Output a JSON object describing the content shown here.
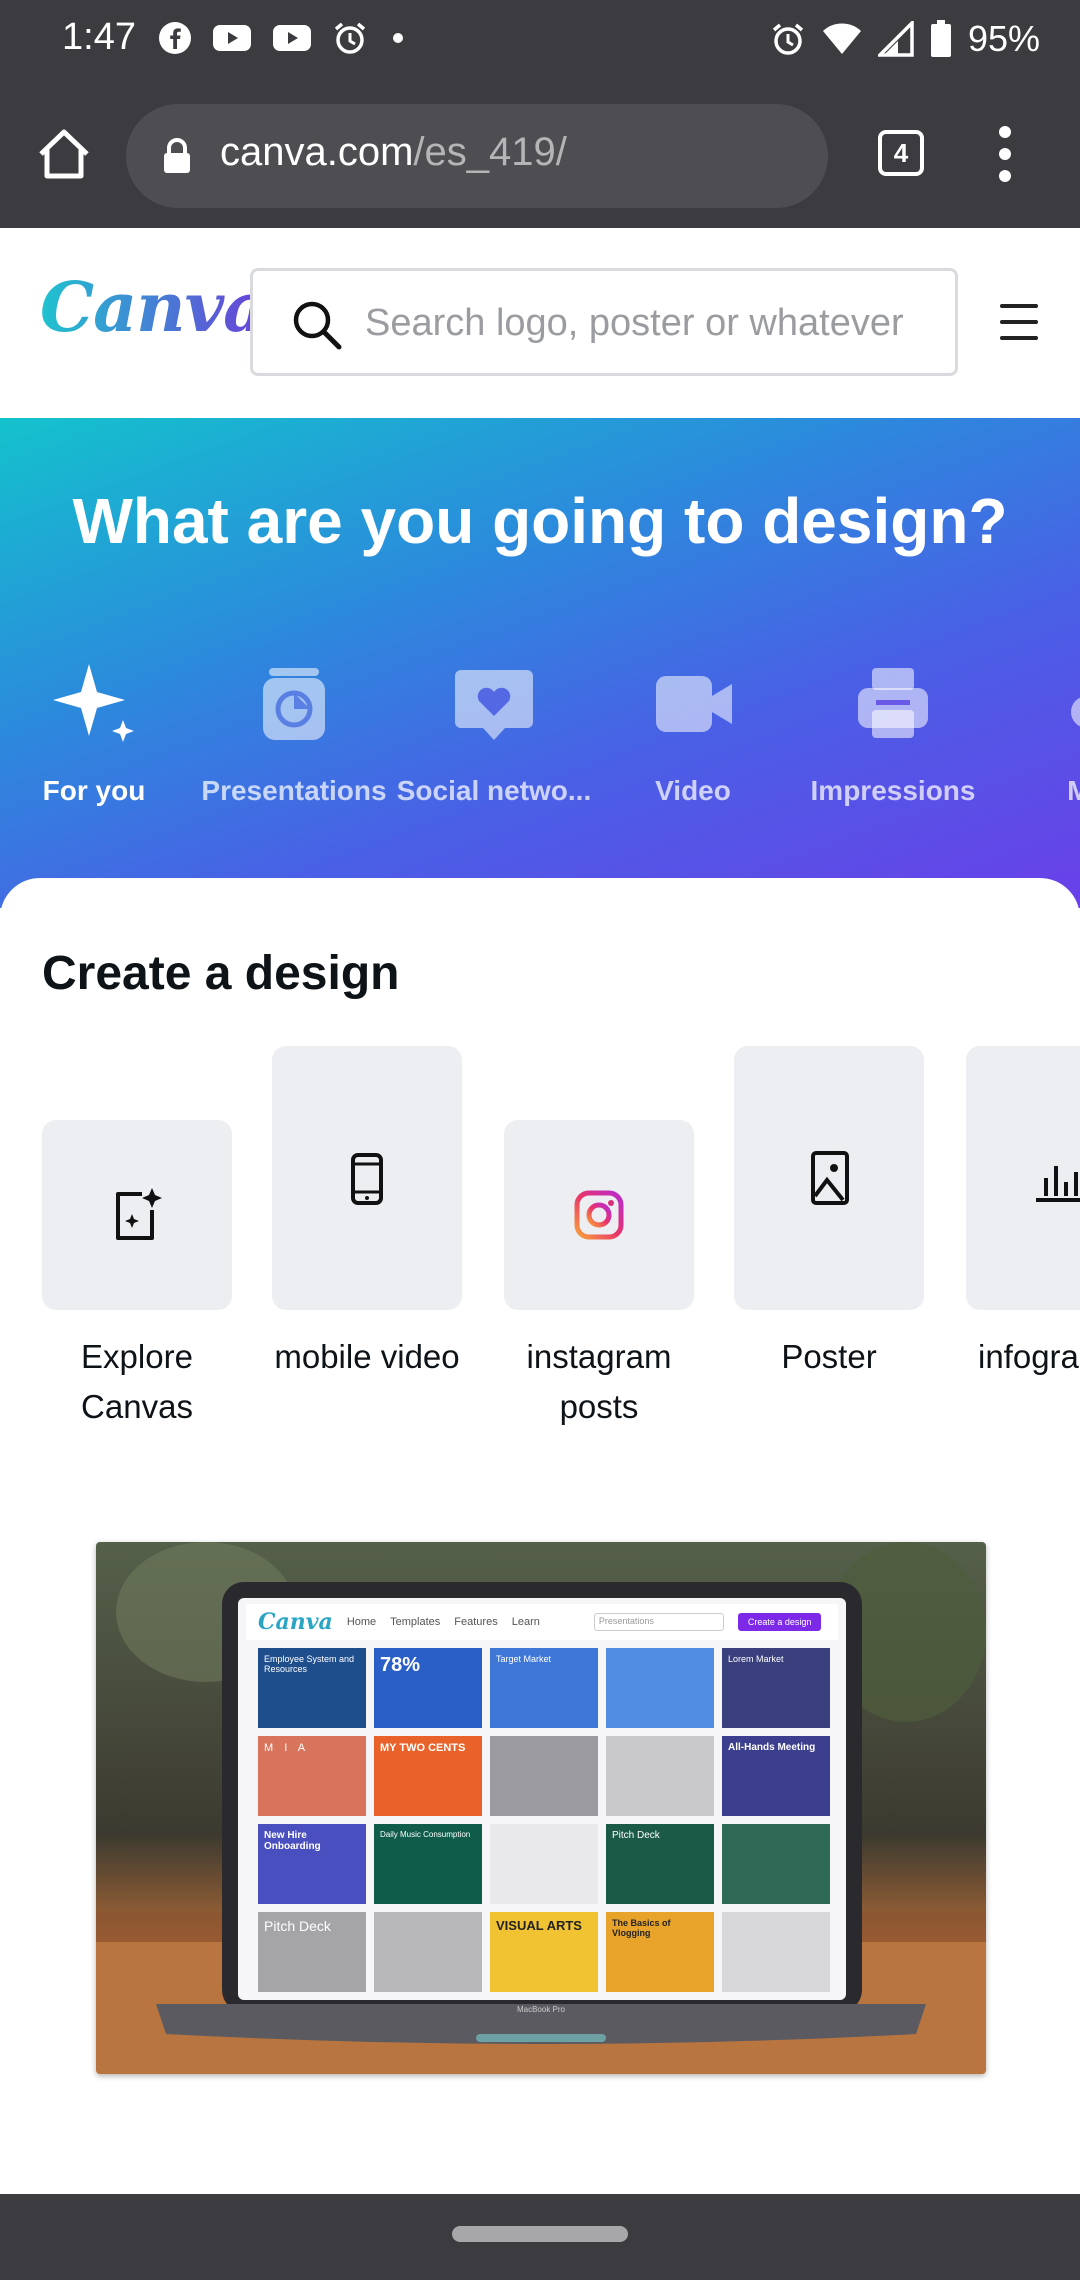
{
  "status_bar": {
    "time": "1:47",
    "battery": "95%",
    "left_icons": [
      "facebook-icon",
      "youtube-icon",
      "youtube-icon",
      "alarm-icon",
      "dot-icon"
    ],
    "right_icons": [
      "alarm-icon",
      "wifi-icon",
      "signal-icon",
      "battery-icon"
    ]
  },
  "browser": {
    "url_host": "canva.com",
    "url_path": "/es_419/",
    "tab_count": "4"
  },
  "header": {
    "logo": "Canva",
    "search_placeholder": "Search logo, poster or whatever"
  },
  "hero": {
    "title": "What are you going to design?",
    "categories": [
      {
        "label": "For you",
        "icon": "sparkle-icon",
        "active": true
      },
      {
        "label": "Presentations",
        "icon": "presentation-icon"
      },
      {
        "label": "Social netwo...",
        "icon": "heart-chat-icon"
      },
      {
        "label": "Video",
        "icon": "video-camera-icon"
      },
      {
        "label": "Impressions",
        "icon": "printer-icon"
      },
      {
        "label": "Mar",
        "icon": "megaphone-icon"
      }
    ]
  },
  "create": {
    "title": "Create a design",
    "cards": [
      {
        "label": "Explore Canvas",
        "icon": "sparkle-doc-icon"
      },
      {
        "label": "mobile video",
        "icon": "phone-icon"
      },
      {
        "label": "instagram posts",
        "icon": "instagram-icon"
      },
      {
        "label": "Poster",
        "icon": "poster-icon"
      },
      {
        "label": "infogra",
        "icon": "bar-chart-icon"
      }
    ]
  },
  "laptop_screen": {
    "logo": "Canva",
    "nav": [
      "Home",
      "Templates",
      "Features",
      "Learn"
    ],
    "search_placeholder": "Presentations",
    "cta": "Create a design",
    "tiles": [
      "Employee System and Resources",
      "78%",
      "Target Market",
      "",
      "Lorem Market",
      "M I A",
      "MY TWO CENTS",
      "",
      "",
      "All-Hands Meeting",
      "New Hire Onboarding",
      "Daily Music Consumption",
      "",
      "Pitch Deck",
      "",
      "Pitch Deck",
      "",
      "VISUAL ARTS",
      "The Basics of Vlogging",
      ""
    ],
    "brand": "MacBook Pro"
  },
  "colors": {
    "chrome": "#3c3c40",
    "hero_start": "#14c2cd",
    "hero_end": "#6a3fe8",
    "canva_purple": "#7d2ae8"
  }
}
